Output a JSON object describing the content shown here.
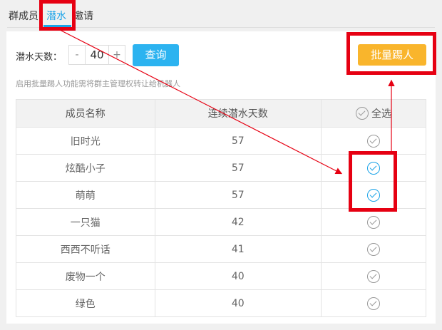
{
  "tabs": [
    {
      "label": "群成员",
      "active": false
    },
    {
      "label": "潜水",
      "active": true
    },
    {
      "label": "邀请",
      "active": false
    }
  ],
  "filter": {
    "days_label": "潜水天数：",
    "minus": "-",
    "plus": "+",
    "days_value": "40",
    "query_label": "查询"
  },
  "kick_button_label": "批量踢人",
  "hint": "启用批量踢人功能需将群主管理权转让给机器人",
  "table": {
    "headers": [
      "成员名称",
      "连续潜水天数",
      "全选"
    ],
    "rows": [
      {
        "name": "旧时光",
        "days": "57",
        "checked": false
      },
      {
        "name": "炫酷小子",
        "days": "57",
        "checked": true
      },
      {
        "name": "萌萌",
        "days": "57",
        "checked": true
      },
      {
        "name": "一只猫",
        "days": "42",
        "checked": false
      },
      {
        "name": "西西不听话",
        "days": "41",
        "checked": false
      },
      {
        "name": "废物一个",
        "days": "40",
        "checked": false
      },
      {
        "name": "绿色",
        "days": "40",
        "checked": false
      }
    ]
  },
  "colors": {
    "accent": "#1aa3e8",
    "kick": "#f9b52c",
    "annotation": "#e60012"
  }
}
